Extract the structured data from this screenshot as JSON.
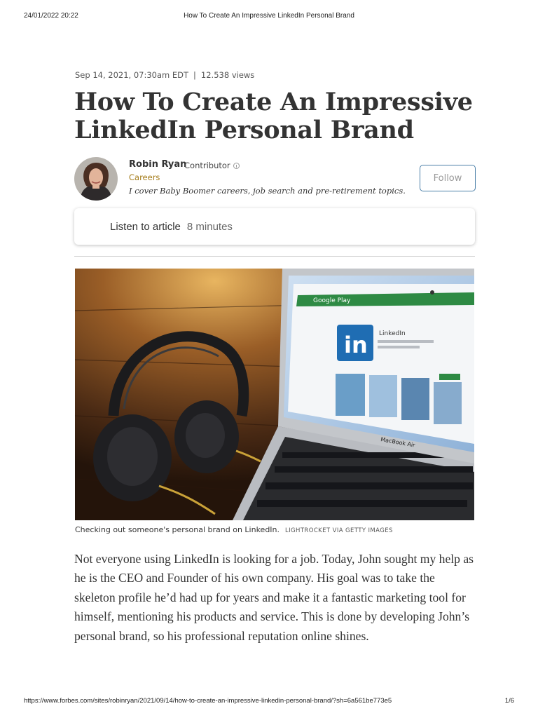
{
  "print_header": {
    "datetime": "24/01/2022 20:22",
    "page_title": "How To Create An Impressive LinkedIn Personal Brand"
  },
  "meta": {
    "published": "Sep 14, 2021, 07:30am EDT",
    "separator": "|",
    "views": "12.538 views"
  },
  "headline": "How To Create An Impressive LinkedIn Personal Brand",
  "author": {
    "name": "Robin Ryan",
    "role": "Contributor",
    "channel": "Careers",
    "bio": "I cover Baby Boomer careers, job search and pre-retirement topics.",
    "follow_label": "Follow"
  },
  "listen": {
    "label": "Listen to article",
    "duration": "8 minutes"
  },
  "hero_image": {
    "screen_brand": "Google Play",
    "app_name": "LinkedIn",
    "logo_text": "in",
    "laptop_label": "MacBook Air",
    "caption": "Checking out someone's personal brand on LinkedIn.",
    "credit": "LIGHTROCKET VIA GETTY IMAGES"
  },
  "body": {
    "paragraph_1": "Not everyone using LinkedIn is looking for a job. Today, John sought my help as he is the CEO and Founder of his own company. His goal was to take the skeleton profile he’d had up for years and make it a fantastic marketing tool for himself, mentioning his products and service. This is done by developing John’s personal brand, so his professional reputation online shines."
  },
  "print_footer": {
    "url": "https://www.forbes.com/sites/robinryan/2021/09/14/how-to-create-an-impressive-linkedin-personal-brand/?sh=6a561be773e5",
    "page": "1/6"
  },
  "colors": {
    "channel_accent": "#a37a17",
    "follow_border": "#4a7fa8",
    "linkedin_blue": "#1f6db3"
  }
}
